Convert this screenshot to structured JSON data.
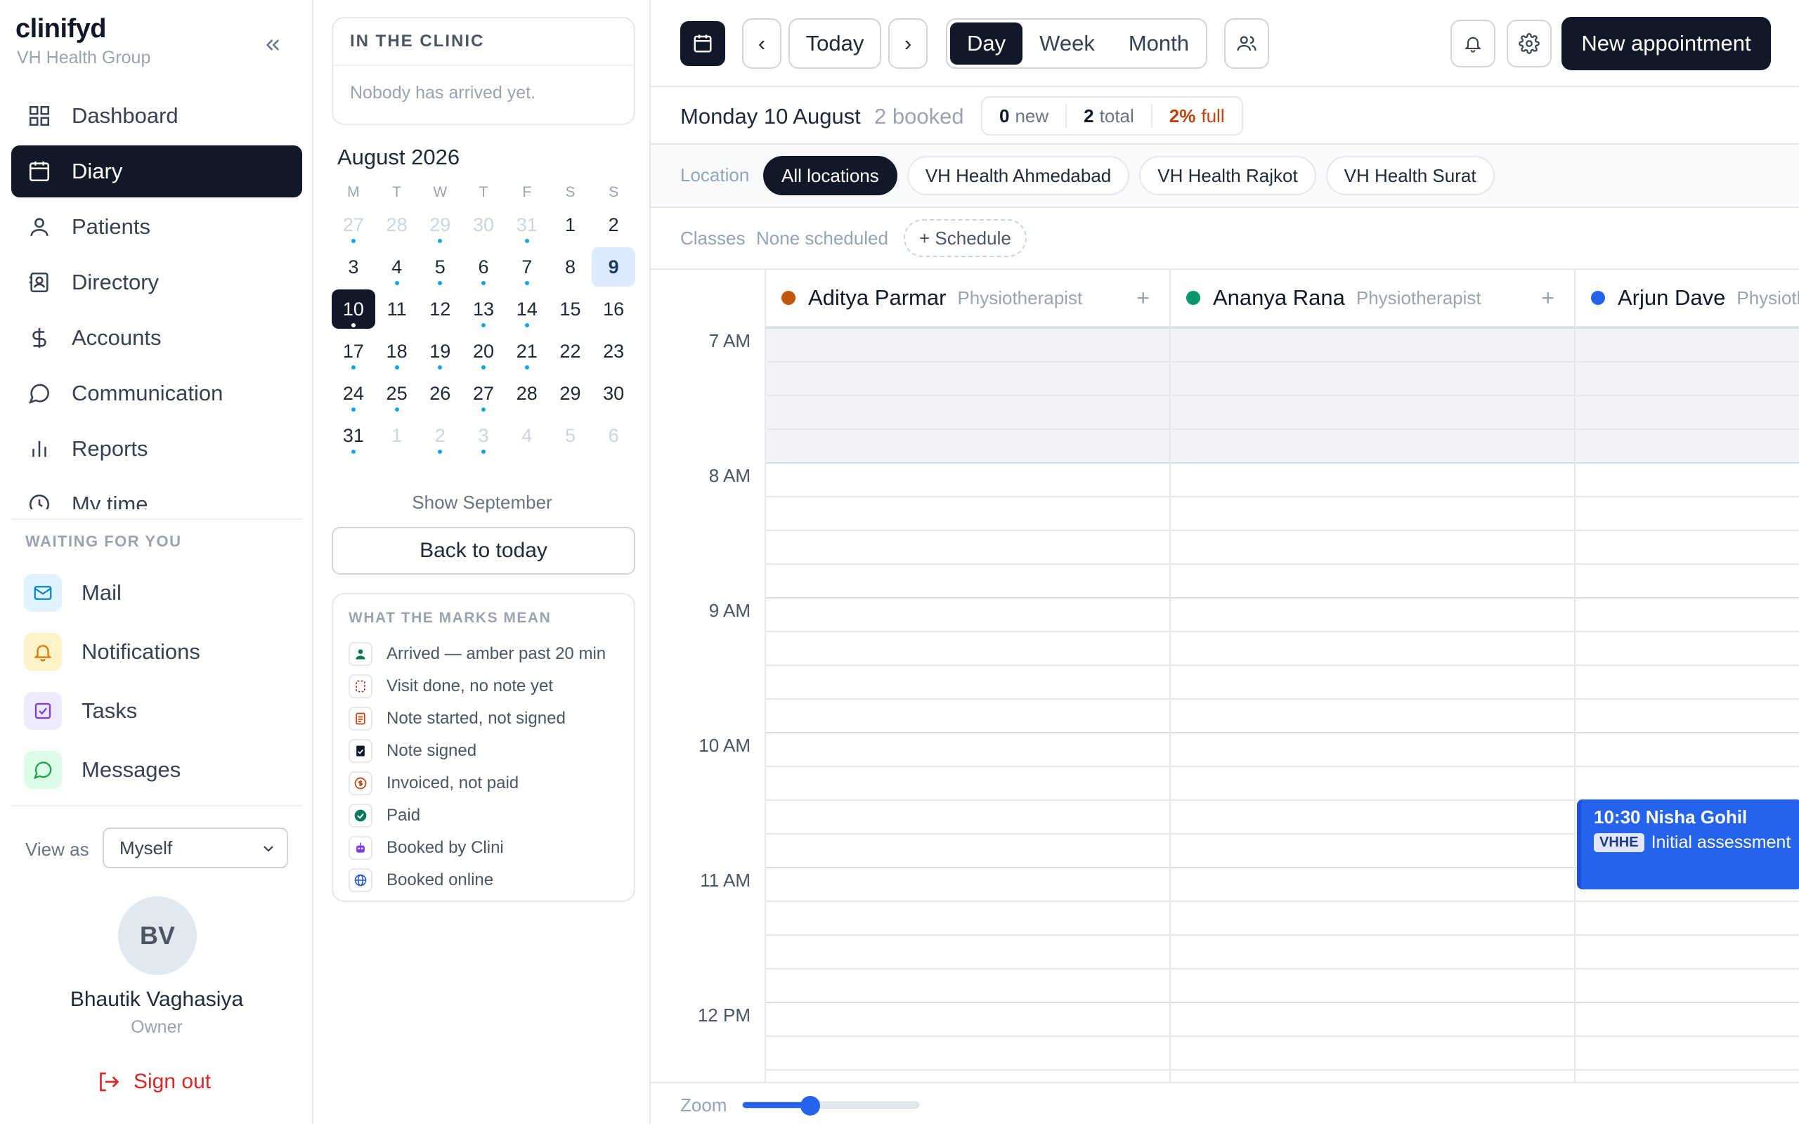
{
  "sidebar": {
    "logo": "clinifyd",
    "org": "VH Health Group",
    "nav": [
      {
        "label": "Dashboard",
        "icon": "grid-icon",
        "active": false
      },
      {
        "label": "Diary",
        "icon": "calendar-icon",
        "active": true
      },
      {
        "label": "Patients",
        "icon": "user-icon",
        "active": false
      },
      {
        "label": "Directory",
        "icon": "contact-book-icon",
        "active": false
      },
      {
        "label": "Accounts",
        "icon": "dollar-icon",
        "active": false
      },
      {
        "label": "Communication",
        "icon": "chat-bubble-icon",
        "active": false
      },
      {
        "label": "Reports",
        "icon": "bar-chart-icon",
        "active": false
      },
      {
        "label": "My time",
        "icon": "clock-icon",
        "active": false
      }
    ],
    "waiting_title": "WAITING FOR YOU",
    "waiting": [
      {
        "label": "Mail",
        "icon": "mail-icon",
        "bg": "#e0f2fe",
        "fg": "#0284c7"
      },
      {
        "label": "Notifications",
        "icon": "bell-icon",
        "bg": "#fef3c7",
        "fg": "#d97706"
      },
      {
        "label": "Tasks",
        "icon": "checkbox-icon",
        "bg": "#ede9fe",
        "fg": "#7c3aed"
      },
      {
        "label": "Messages",
        "icon": "message-icon",
        "bg": "#dcfce7",
        "fg": "#16a34a"
      }
    ],
    "view_as_label": "View as",
    "view_as_value": "Myself",
    "user": {
      "initials": "BV",
      "name": "Bhautik Vaghasiya",
      "role": "Owner"
    },
    "sign_out": "Sign out"
  },
  "clinic": {
    "title": "IN THE CLINIC",
    "empty": "Nobody has arrived yet."
  },
  "calendar": {
    "month": "August 2026",
    "weekdays": [
      "M",
      "T",
      "W",
      "T",
      "F",
      "S",
      "S"
    ],
    "weeks": [
      [
        {
          "d": "27",
          "m": true,
          "dot": true
        },
        {
          "d": "28",
          "m": true
        },
        {
          "d": "29",
          "m": true,
          "dot": true
        },
        {
          "d": "30",
          "m": true
        },
        {
          "d": "31",
          "m": true,
          "dot": true
        },
        {
          "d": "1"
        },
        {
          "d": "2"
        }
      ],
      [
        {
          "d": "3"
        },
        {
          "d": "4",
          "dot": true
        },
        {
          "d": "5",
          "dot": true
        },
        {
          "d": "6",
          "dot": true
        },
        {
          "d": "7",
          "dot": true
        },
        {
          "d": "8"
        },
        {
          "d": "9",
          "today": true
        }
      ],
      [
        {
          "d": "10",
          "sel": true,
          "dot": true
        },
        {
          "d": "11"
        },
        {
          "d": "12"
        },
        {
          "d": "13",
          "dot": true
        },
        {
          "d": "14",
          "dot": true
        },
        {
          "d": "15"
        },
        {
          "d": "16"
        }
      ],
      [
        {
          "d": "17",
          "dot": true
        },
        {
          "d": "18",
          "dot": true
        },
        {
          "d": "19",
          "dot": true
        },
        {
          "d": "20",
          "dot": true
        },
        {
          "d": "21",
          "dot": true
        },
        {
          "d": "22"
        },
        {
          "d": "23"
        }
      ],
      [
        {
          "d": "24",
          "dot": true
        },
        {
          "d": "25",
          "dot": true
        },
        {
          "d": "26"
        },
        {
          "d": "27",
          "dot": true
        },
        {
          "d": "28"
        },
        {
          "d": "29"
        },
        {
          "d": "30"
        }
      ],
      [
        {
          "d": "31",
          "dot": true
        },
        {
          "d": "1",
          "m": true
        },
        {
          "d": "2",
          "m": true,
          "dot": true
        },
        {
          "d": "3",
          "m": true,
          "dot": true
        },
        {
          "d": "4",
          "m": true
        },
        {
          "d": "5",
          "m": true
        },
        {
          "d": "6",
          "m": true
        }
      ]
    ],
    "show_next": "Show September",
    "back_today": "Back to today"
  },
  "legend": {
    "title": "WHAT THE MARKS MEAN",
    "items": [
      {
        "label": "Arrived — amber past 20 min",
        "icon": "person-icon"
      },
      {
        "label": "Visit done, no note yet",
        "icon": "dashed-note-icon"
      },
      {
        "label": "Note started, not signed",
        "icon": "document-icon"
      },
      {
        "label": "Note signed",
        "icon": "signed-document-icon"
      },
      {
        "label": "Invoiced, not paid",
        "icon": "coin-icon"
      },
      {
        "label": "Paid",
        "icon": "check-circle-icon"
      },
      {
        "label": "Booked by Clini",
        "icon": "robot-icon"
      },
      {
        "label": "Booked online",
        "icon": "globe-icon"
      }
    ]
  },
  "toolbar": {
    "today": "Today",
    "prev": "‹",
    "next": "›",
    "views": [
      "Day",
      "Week",
      "Month"
    ],
    "active_view": "Day",
    "new_appointment": "New appointment"
  },
  "day": {
    "title": "Monday 10 August",
    "booked": "2 booked",
    "stats": {
      "new_num": "0",
      "new_label": "new",
      "total_num": "2",
      "total_label": "total",
      "full_num": "2%",
      "full_label": "full"
    }
  },
  "locations": {
    "label": "Location",
    "items": [
      "All locations",
      "VH Health Ahmedabad",
      "VH Health Rajkot",
      "VH Health Surat"
    ],
    "active": "All locations"
  },
  "classes": {
    "label": "Classes",
    "none": "None scheduled",
    "schedule": "+ Schedule"
  },
  "practitioners": [
    {
      "name": "Aditya Parmar",
      "role": "Physiotherapist",
      "color": "#c2570c"
    },
    {
      "name": "Ananya Rana",
      "role": "Physiotherapist",
      "color": "#059669"
    },
    {
      "name": "Arjun Dave",
      "role": "Physiotherapist",
      "color": "#2563eb"
    }
  ],
  "times": [
    "7 AM",
    "8 AM",
    "9 AM",
    "10 AM",
    "11 AM",
    "12 PM"
  ],
  "appointments": [
    {
      "time": "10:30",
      "patient": "Nisha Gohil",
      "tag": "VHHE",
      "type": "Initial assessment",
      "practitioner": 2,
      "start": "10:30",
      "end": "11:10"
    }
  ],
  "zoom": {
    "label": "Zoom",
    "value": 0.38
  }
}
